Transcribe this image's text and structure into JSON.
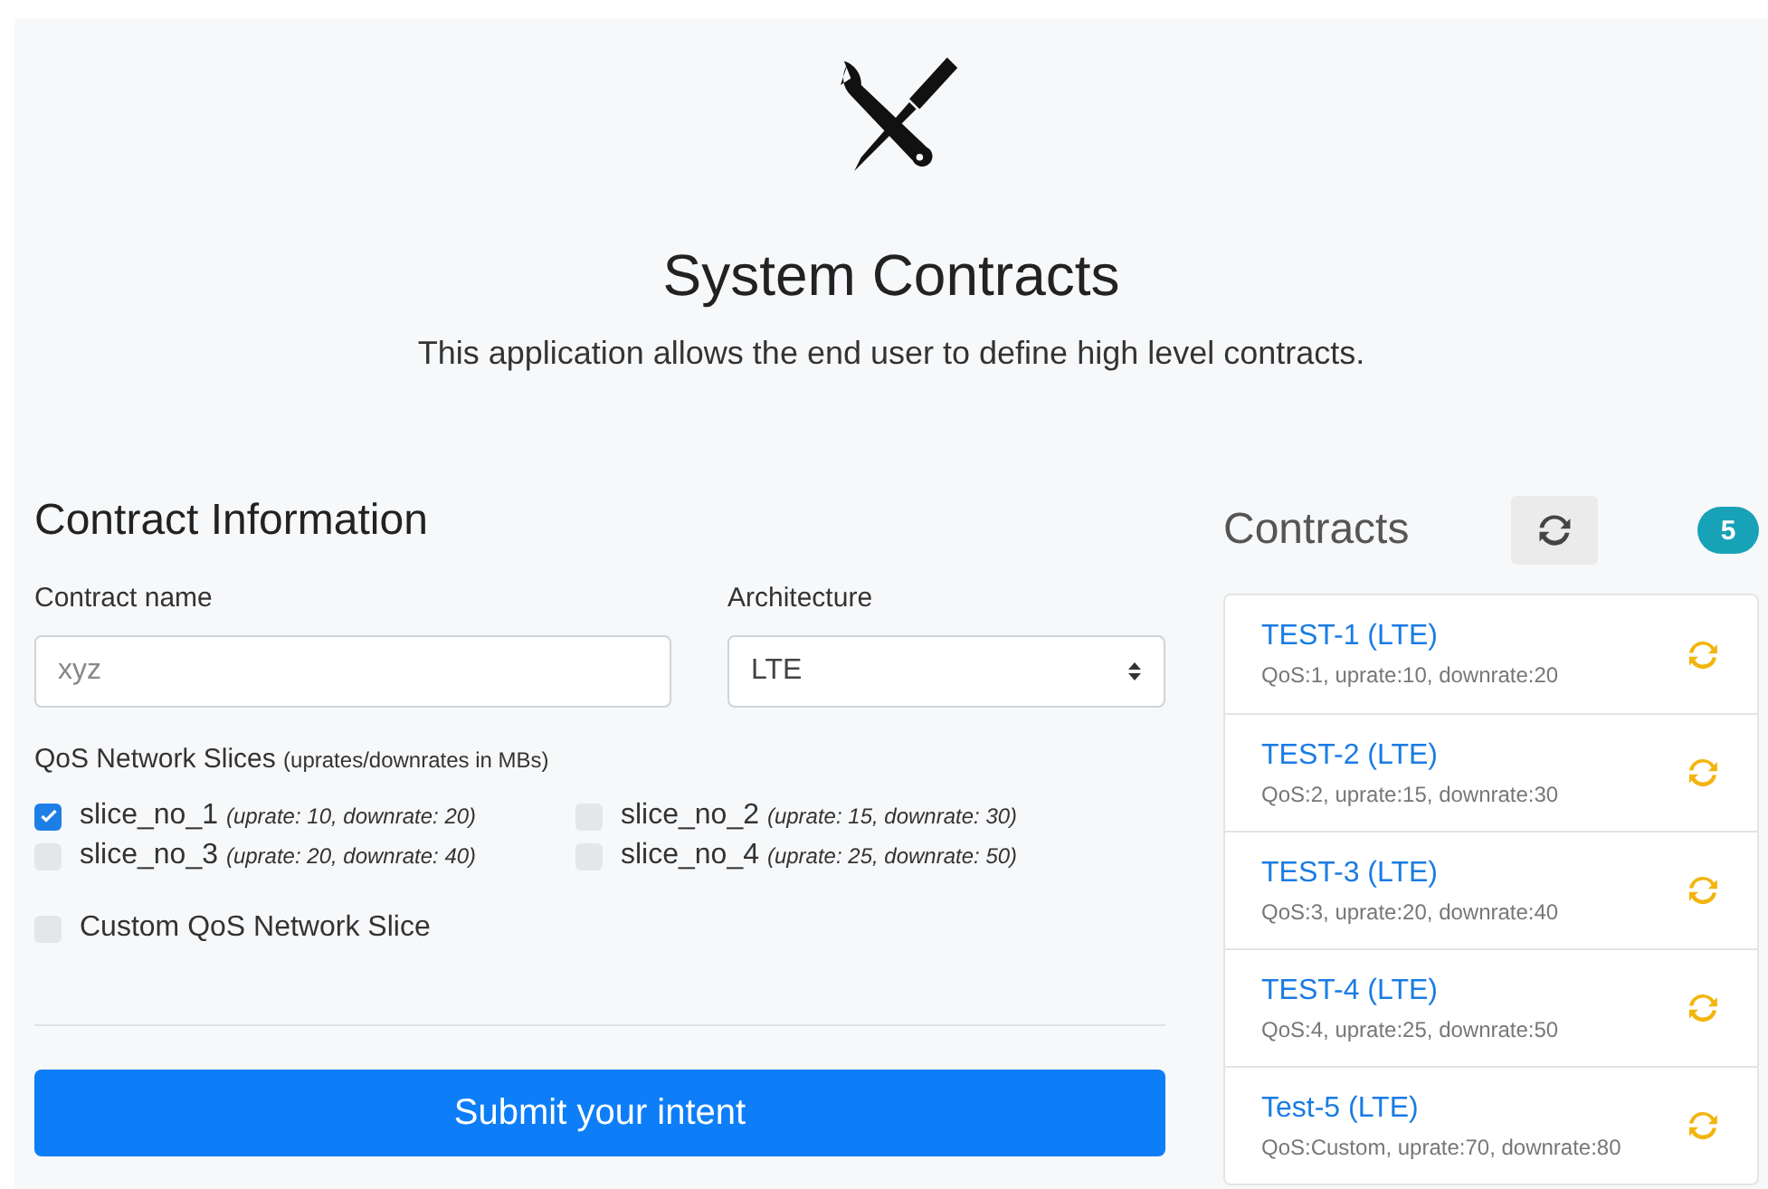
{
  "header": {
    "title": "System Contracts",
    "subtitle": "This application allows the end user to define high level contracts."
  },
  "form": {
    "title": "Contract Information",
    "name_label": "Contract name",
    "name_placeholder": "xyz",
    "architecture_label": "Architecture",
    "architecture_value": "LTE",
    "slices_label": "QoS Network Slices",
    "slices_note": "(uprates/downrates in MBs)",
    "slices": [
      {
        "name": "slice_no_1",
        "detail": "(uprate: 10, downrate: 20)",
        "checked": true
      },
      {
        "name": "slice_no_2",
        "detail": "(uprate: 15, downrate: 30)",
        "checked": false
      },
      {
        "name": "slice_no_3",
        "detail": "(uprate: 20, downrate: 40)",
        "checked": false
      },
      {
        "name": "slice_no_4",
        "detail": "(uprate: 25, downrate: 50)",
        "checked": false
      }
    ],
    "custom": {
      "label": "Custom QoS Network Slice",
      "checked": false
    },
    "submit": "Submit your intent"
  },
  "contracts": {
    "title": "Contracts",
    "count": "5",
    "items": [
      {
        "name": "TEST-1 (LTE)",
        "detail": "QoS:1, uprate:10, downrate:20"
      },
      {
        "name": "TEST-2 (LTE)",
        "detail": "QoS:2, uprate:15, downrate:30"
      },
      {
        "name": "TEST-3 (LTE)",
        "detail": "QoS:3, uprate:20, downrate:40"
      },
      {
        "name": "TEST-4 (LTE)",
        "detail": "QoS:4, uprate:25, downrate:50"
      },
      {
        "name": "Test-5 (LTE)",
        "detail": "QoS:Custom, uprate:70, downrate:80"
      }
    ]
  }
}
